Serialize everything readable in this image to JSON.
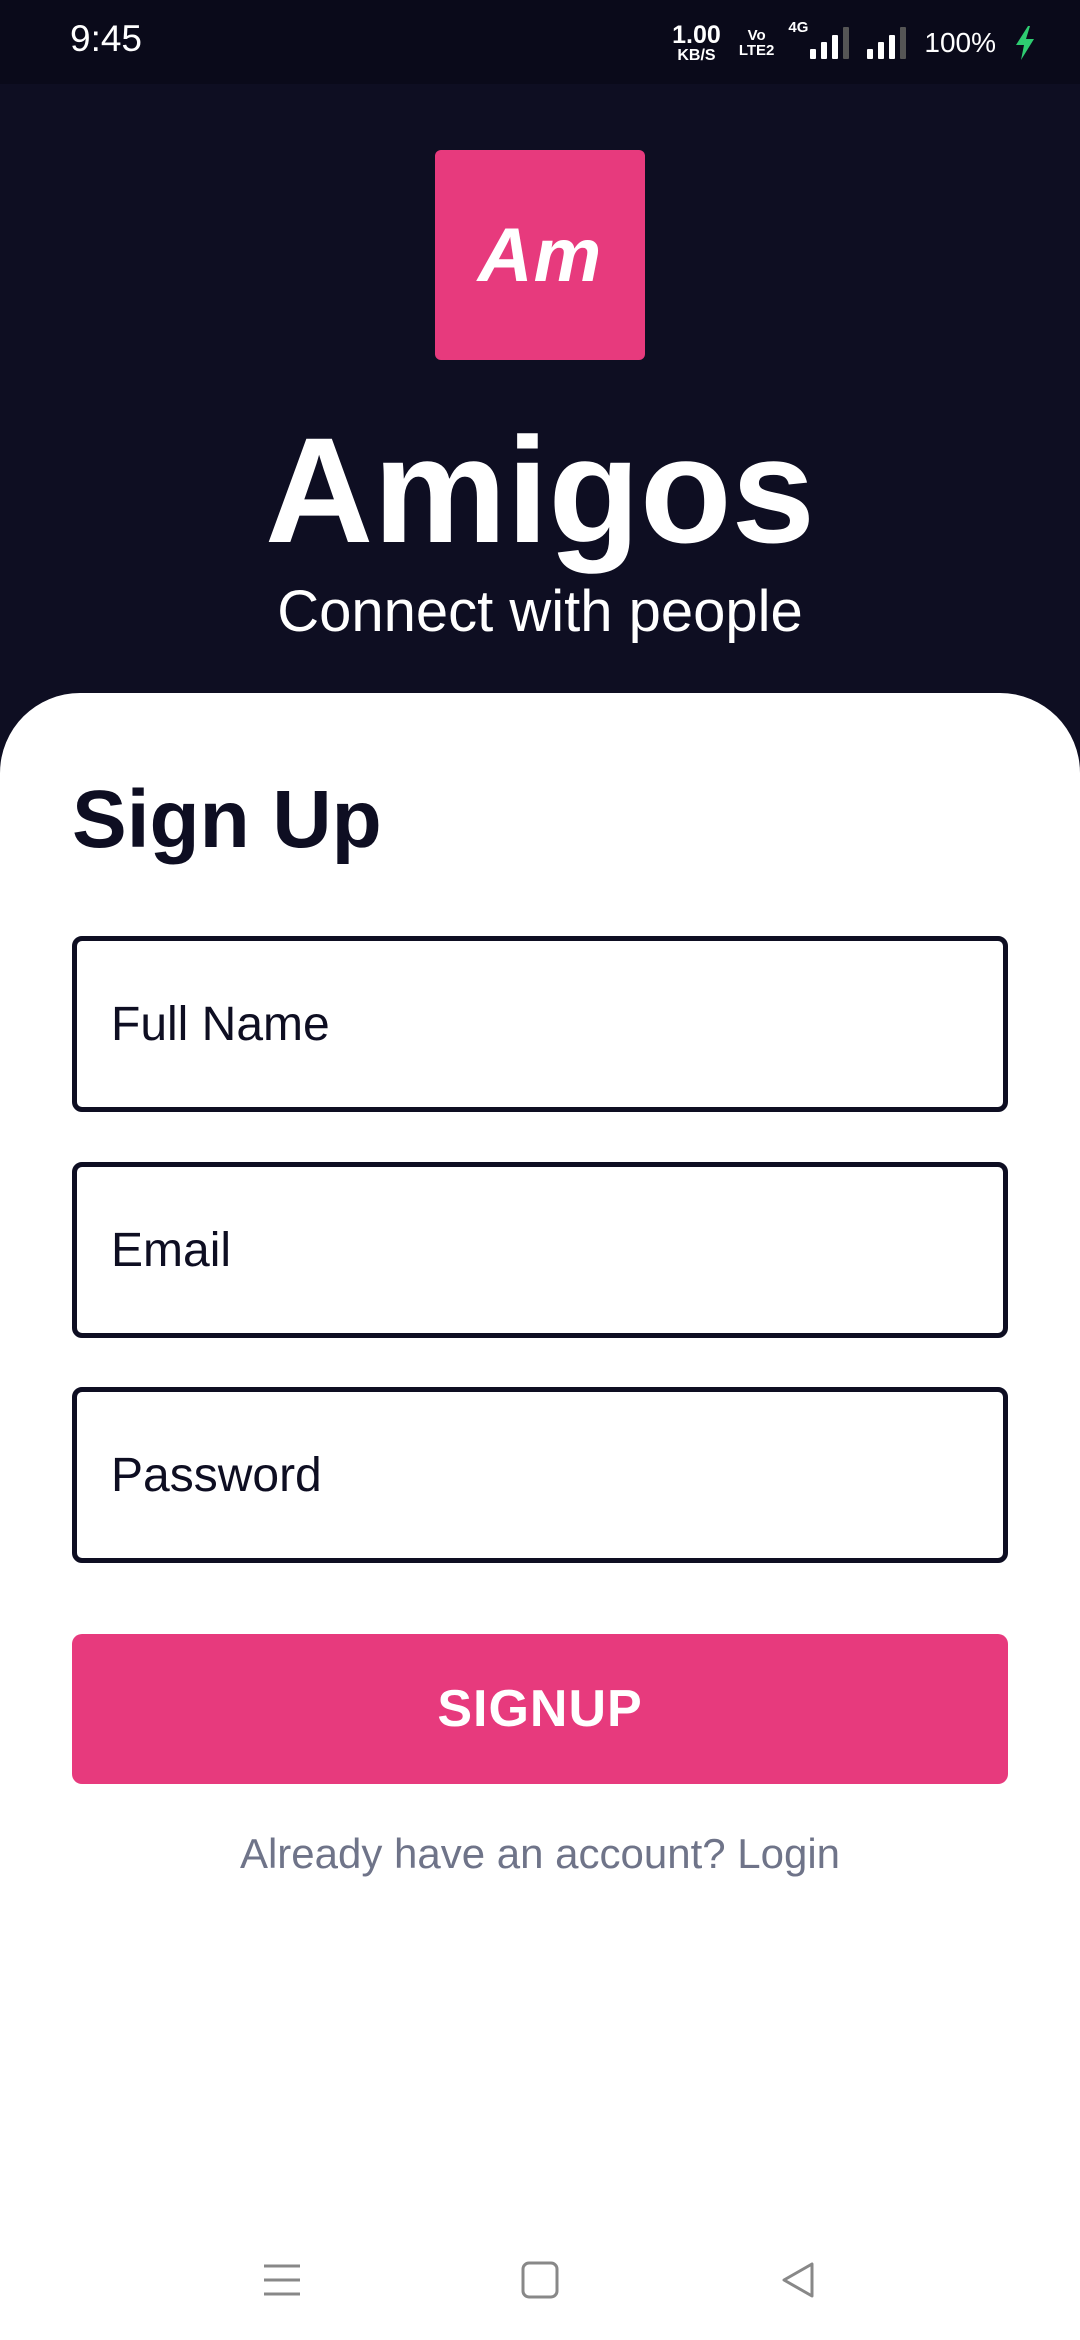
{
  "status_bar": {
    "time": "9:45",
    "net_speed_value": "1.00",
    "net_speed_unit": "KB/S",
    "volte_top": "Vo",
    "volte_bottom": "LTE2",
    "network_type": "4G",
    "battery": "100%",
    "icons": [
      "network-speed-icon",
      "volte-icon",
      "signal-4g-icon",
      "signal-icon",
      "charging-bolt-icon"
    ]
  },
  "header": {
    "logo_text": "Am",
    "app_name": "Amigos",
    "tagline": "Connect with people"
  },
  "form": {
    "title": "Sign Up",
    "full_name": {
      "value": "",
      "placeholder": "Full Name"
    },
    "email": {
      "value": "",
      "placeholder": "Email"
    },
    "password": {
      "value": "",
      "placeholder": "Password"
    },
    "submit_label": "SIGNUP",
    "login_prompt": "Already have an account? Login"
  },
  "colors": {
    "header_bg": "#0e0e22",
    "accent": "#e73a7d",
    "link_gray": "#6f7489"
  },
  "nav_bar": {
    "icons": [
      "menu-icon",
      "home-icon",
      "back-icon"
    ]
  }
}
